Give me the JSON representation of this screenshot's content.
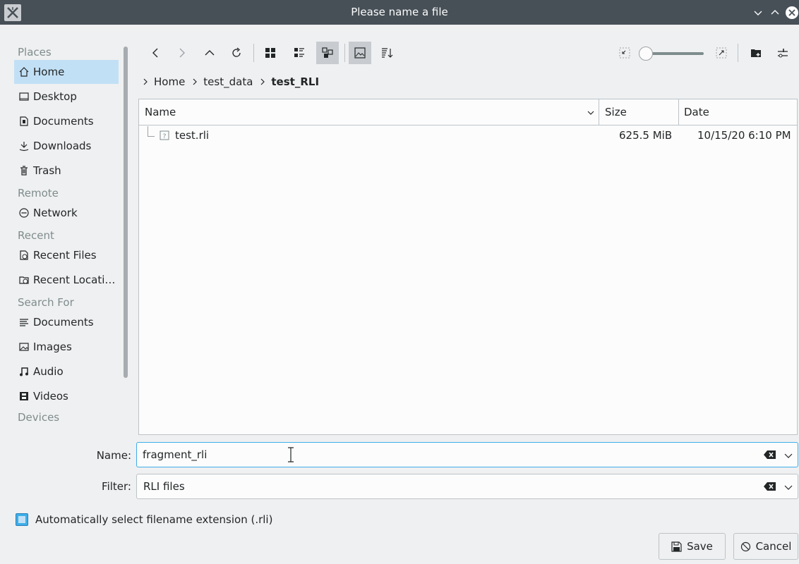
{
  "window": {
    "title": "Please name a file"
  },
  "sidebar": {
    "sections": {
      "places": "Places",
      "remote": "Remote",
      "recent": "Recent",
      "search": "Search For",
      "devices": "Devices"
    },
    "items": [
      {
        "label": "Home",
        "icon": "home-icon"
      },
      {
        "label": "Desktop",
        "icon": "desktop-icon"
      },
      {
        "label": "Documents",
        "icon": "documents-icon"
      },
      {
        "label": "Downloads",
        "icon": "downloads-icon"
      },
      {
        "label": "Trash",
        "icon": "trash-icon"
      },
      {
        "label": "Network",
        "icon": "network-icon"
      },
      {
        "label": "Recent Files",
        "icon": "recent-files-icon"
      },
      {
        "label": "Recent Locati…",
        "icon": "recent-locations-icon"
      },
      {
        "label": "Documents",
        "icon": "search-documents-icon"
      },
      {
        "label": "Images",
        "icon": "images-icon"
      },
      {
        "label": "Audio",
        "icon": "audio-icon"
      },
      {
        "label": "Videos",
        "icon": "videos-icon"
      }
    ]
  },
  "breadcrumb": {
    "items": [
      "Home",
      "test_data"
    ],
    "current": "test_RLI"
  },
  "table": {
    "columns": {
      "name": "Name",
      "size": "Size",
      "date": "Date"
    },
    "rows": [
      {
        "name": "test.rli",
        "size": "625.5 MiB",
        "date": "10/15/20 6:10 PM"
      }
    ]
  },
  "form": {
    "name_label": "Name:",
    "name_value": "fragment_rli",
    "filter_label": "Filter:",
    "filter_value": "RLI files",
    "auto_ext_label": "Automatically select filename extension (.rli)"
  },
  "buttons": {
    "save": "Save",
    "cancel": "Cancel"
  },
  "colors": {
    "accent": "#3daee9",
    "selection": "#c2e0f5",
    "titlebar": "#475057"
  }
}
